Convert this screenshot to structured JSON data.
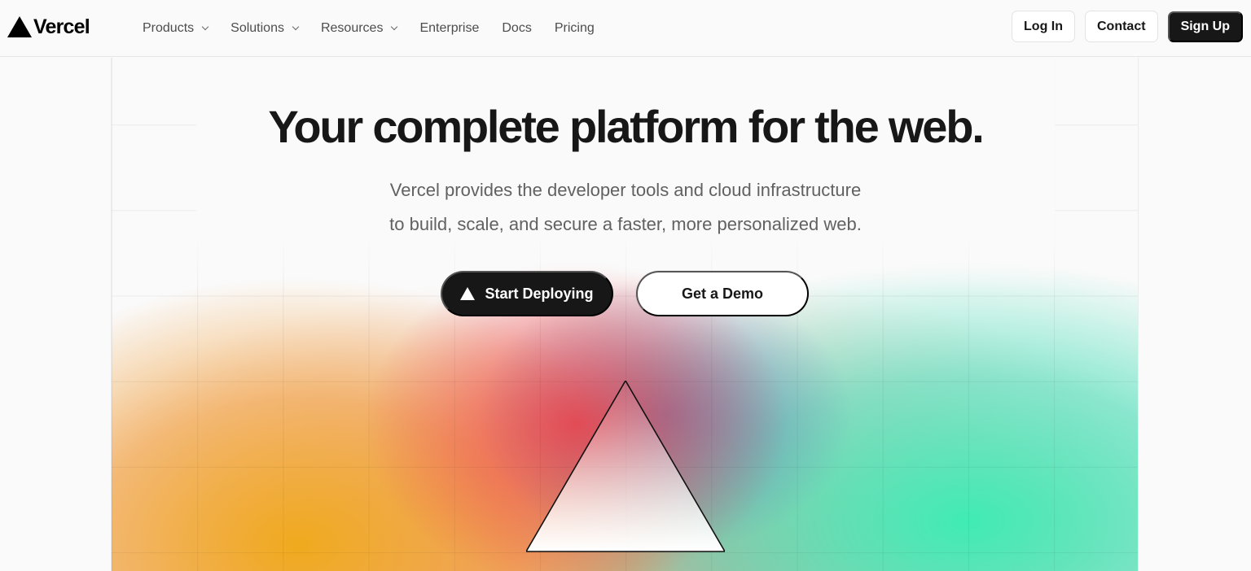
{
  "brand": {
    "name": "Vercel"
  },
  "nav": {
    "items": [
      {
        "label": "Products",
        "has_menu": true
      },
      {
        "label": "Solutions",
        "has_menu": true
      },
      {
        "label": "Resources",
        "has_menu": true
      },
      {
        "label": "Enterprise",
        "has_menu": false
      },
      {
        "label": "Docs",
        "has_menu": false
      },
      {
        "label": "Pricing",
        "has_menu": false
      }
    ]
  },
  "header_actions": {
    "login": "Log In",
    "contact": "Contact",
    "signup": "Sign Up"
  },
  "hero": {
    "title": "Your complete platform for the web.",
    "subtitle_line1": "Vercel provides the developer tools and cloud infrastructure",
    "subtitle_line2": "to build, scale, and secure a faster, more personalized web.",
    "primary_cta": "Start Deploying",
    "secondary_cta": "Get a Demo"
  },
  "icons": {
    "logo": "vercel-triangle-icon",
    "chevron": "chevron-down-icon",
    "cta_icon": "vercel-triangle-icon",
    "hero_graphic": "prism-triangle-graphic"
  },
  "colors": {
    "accent_dark": "#171717",
    "background": "#fafafa",
    "glow_orange": "#f0aa1e",
    "glow_red": "#ec3c46",
    "glow_blue": "#5078be",
    "glow_green": "#40ebb4"
  }
}
